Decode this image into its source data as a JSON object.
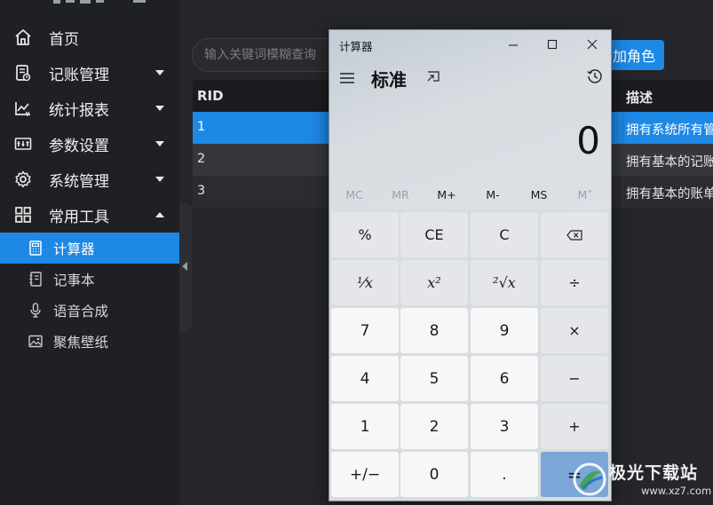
{
  "sidebar": {
    "menu": [
      {
        "label": "首页",
        "icon": "home-icon"
      },
      {
        "label": "记账管理",
        "icon": "ledger-icon"
      },
      {
        "label": "统计报表",
        "icon": "chart-icon"
      },
      {
        "label": "参数设置",
        "icon": "parameters-icon"
      },
      {
        "label": "系统管理",
        "icon": "gear-icon"
      },
      {
        "label": "常用工具",
        "icon": "grid-icon"
      }
    ],
    "tools": [
      {
        "label": "计算器",
        "icon": "calculator-icon",
        "active": true
      },
      {
        "label": "记事本",
        "icon": "notebook-icon"
      },
      {
        "label": "语音合成",
        "icon": "microphone-icon"
      },
      {
        "label": "聚焦壁纸",
        "icon": "picture-icon"
      }
    ]
  },
  "toolbar": {
    "search_placeholder": "输入关键词模糊查询",
    "add_button_visible": "加角色"
  },
  "table": {
    "columns": [
      "RID",
      "描述"
    ],
    "rows": [
      {
        "rid": "1",
        "desc": "拥有系统所有管",
        "selected": true
      },
      {
        "rid": "2",
        "desc": "拥有基本的记账"
      },
      {
        "rid": "3",
        "desc": "拥有基本的账单"
      }
    ]
  },
  "calculator": {
    "window_title": "计算器",
    "mode": "标准",
    "display": "0",
    "memory": [
      "MC",
      "MR",
      "M+",
      "M-",
      "MS",
      "M˅"
    ],
    "keys": [
      [
        "%",
        "CE",
        "C",
        "⌫"
      ],
      [
        "¹⁄x",
        "x²",
        "²√x",
        "÷"
      ],
      [
        "7",
        "8",
        "9",
        "×"
      ],
      [
        "4",
        "5",
        "6",
        "−"
      ],
      [
        "1",
        "2",
        "3",
        "+"
      ],
      [
        "+/−",
        "0",
        ".",
        "="
      ]
    ]
  },
  "watermark": {
    "text": "极光下载站",
    "url": "www.xz7.com"
  },
  "colors": {
    "accent": "#1e88e5",
    "sidebar_bg": "#1f2024",
    "main_bg": "#25262b",
    "equals_key": "#7aa7d8"
  }
}
